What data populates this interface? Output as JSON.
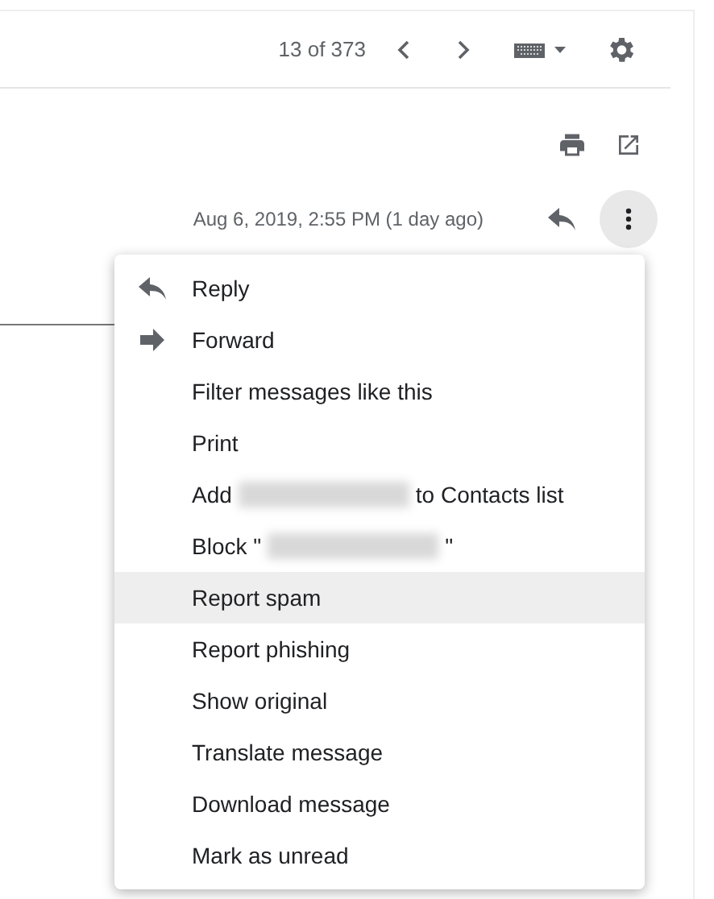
{
  "toolbar": {
    "counter": "13 of 373"
  },
  "message": {
    "date": "Aug 6, 2019, 2:55 PM (1 day ago)"
  },
  "menu": {
    "items": [
      {
        "kind": "reply",
        "label": "Reply",
        "selected": false
      },
      {
        "kind": "forward",
        "label": "Forward",
        "selected": false
      },
      {
        "kind": "plain",
        "label": "Filter messages like this",
        "selected": false
      },
      {
        "kind": "plain",
        "label": "Print",
        "selected": false
      },
      {
        "kind": "redacted",
        "before": "Add",
        "after": "to Contacts list",
        "selected": false
      },
      {
        "kind": "redacted",
        "before": "Block \"",
        "after": "\"",
        "selected": false
      },
      {
        "kind": "plain",
        "label": "Report spam",
        "selected": true
      },
      {
        "kind": "plain",
        "label": "Report phishing",
        "selected": false
      },
      {
        "kind": "plain",
        "label": "Show original",
        "selected": false
      },
      {
        "kind": "plain",
        "label": "Translate message",
        "selected": false
      },
      {
        "kind": "plain",
        "label": "Download message",
        "selected": false
      },
      {
        "kind": "plain",
        "label": "Mark as unread",
        "selected": false
      }
    ]
  }
}
